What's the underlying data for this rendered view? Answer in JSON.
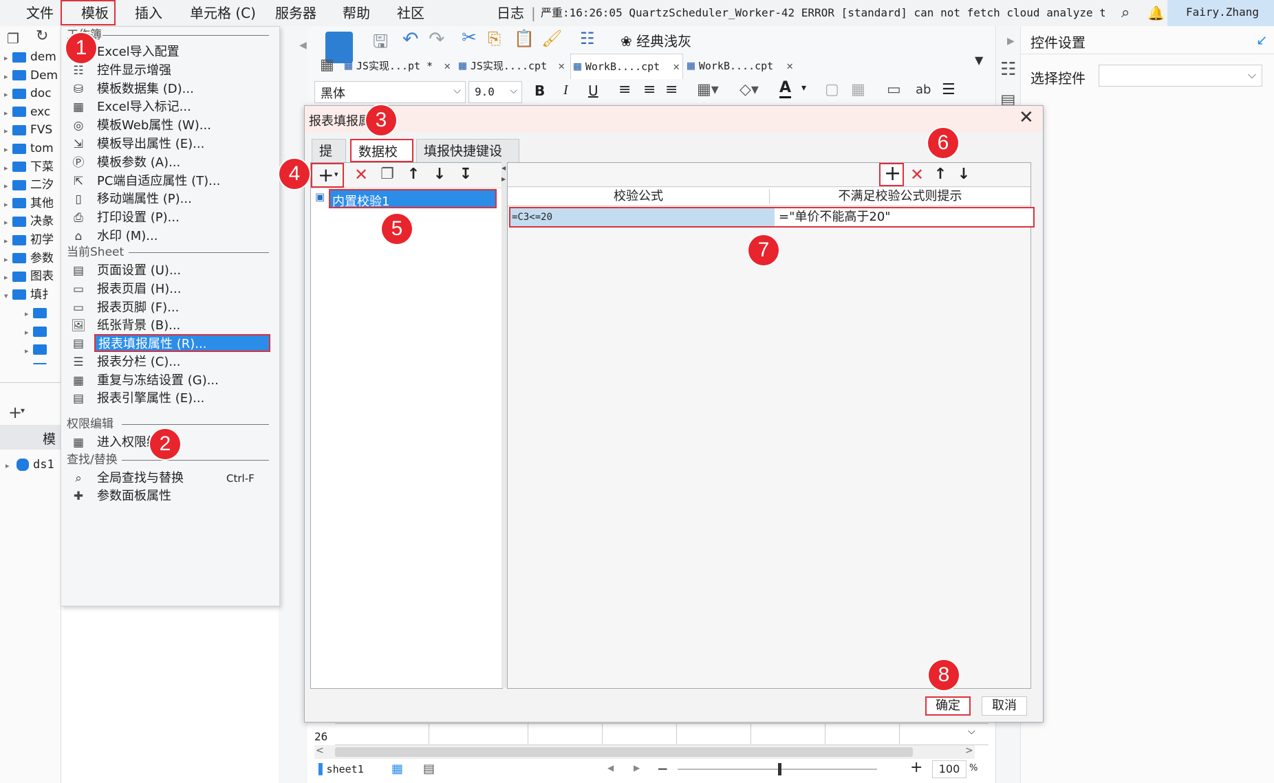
{
  "menubar": {
    "items": [
      "文件",
      "模板",
      "插入",
      "单元格 (C)",
      "服务器",
      "帮助",
      "社区"
    ],
    "log_label": "日志",
    "log_message": "严重:16:26:05 QuartzScheduler_Worker-42 ERROR [standard] can not fetch cloud analyze token.",
    "user": "Fairy.Zhang"
  },
  "left_tree": {
    "items": [
      "dem",
      "Dem",
      "doc",
      "exc",
      "FVS",
      "tom",
      "下菜",
      "二汐",
      "其他",
      "决彖",
      "初学",
      "参数",
      "图表",
      "填扌"
    ],
    "datasets_label": "模",
    "dataset_item": "ds1"
  },
  "dropdown": {
    "section_template": "工作簿",
    "items_top": [
      "Excel导入配置",
      "控件显示增强",
      "模板数据集 (D)...",
      "Excel导入标记...",
      "模板Web属性 (W)...",
      "模板导出属性 (E)...",
      "模板参数 (A)...",
      "PC端自适应属性 (T)...",
      "移动端属性 (P)...",
      "打印设置 (P)...",
      "水印 (M)..."
    ],
    "section_sheet": "当前Sheet",
    "items_sheet": [
      "页面设置 (U)...",
      "报表页眉 (H)...",
      "报表页脚 (F)...",
      "纸张背景 (B)...",
      "报表填报属性 (R)...",
      "报表分栏 (C)...",
      "重复与冻结设置 (G)...",
      "报表引擎属性 (E)..."
    ],
    "section_auth": "权限编辑",
    "items_auth": [
      "进入权限编辑"
    ],
    "section_find": "查找/替换",
    "find_item": "全局查找与替换",
    "find_shortcut": "Ctrl-F",
    "params_item": "参数面板属性"
  },
  "toolbar": {
    "theme_label": "经典浅灰",
    "tabs": [
      "JS实现...pt *",
      "JS实现....cpt",
      "WorkB....cpt",
      "WorkB....cpt"
    ],
    "font_name": "黑体",
    "font_size": "9.0"
  },
  "right_panel": {
    "title": "控件设置",
    "select_label": "选择控件"
  },
  "dialog": {
    "title": "报表填报属性",
    "tabs": [
      "提交",
      "数据校验",
      "填报快捷键设置"
    ],
    "validation_items": [
      "内置校验1"
    ],
    "columns": [
      "校验公式",
      "不满足校验公式则提示"
    ],
    "rows": [
      {
        "formula": "=C3<=20",
        "message": "=\"单价不能高于20\""
      }
    ],
    "ok_label": "确定",
    "cancel_label": "取消"
  },
  "bottom": {
    "row_number": "26",
    "sheet_name": "sheet1",
    "zoom": "100",
    "zoom_unit": "%"
  },
  "badges": [
    "1",
    "2",
    "3",
    "4",
    "5",
    "6",
    "7",
    "8"
  ],
  "colors": {
    "accent": "#1f7be0",
    "highlight": "#2b8de8",
    "annotation": "#e8242c"
  }
}
